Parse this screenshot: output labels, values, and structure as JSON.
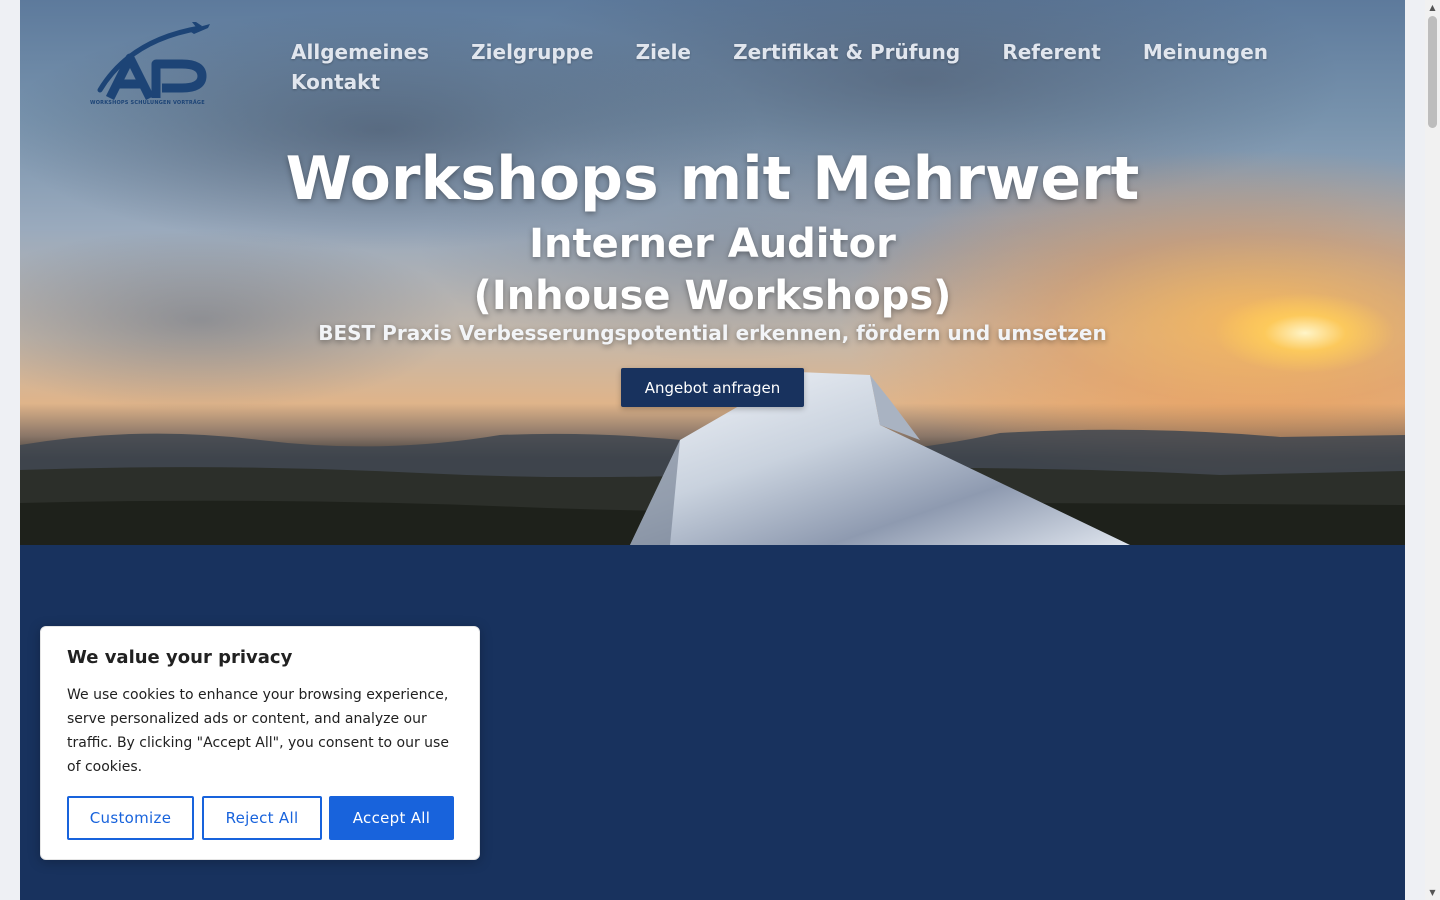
{
  "logo": {
    "icon": "airplane-icon",
    "letters": "AP",
    "tagline": "WORKSHOPS SCHULUNGEN VORTRÄGE",
    "color": "#1d4476"
  },
  "nav": {
    "items": [
      {
        "label": "Allgemeines"
      },
      {
        "label": "Zielgruppe"
      },
      {
        "label": "Ziele"
      },
      {
        "label": "Zertifikat & Prüfung"
      },
      {
        "label": "Referent"
      },
      {
        "label": "Meinungen"
      },
      {
        "label": "Kontakt"
      }
    ]
  },
  "hero": {
    "title": "Workshops mit Mehrwert",
    "subtitle_line1": "Interner Auditor",
    "subtitle_line2": "(Inhouse Workshops)",
    "tagline": "BEST Praxis Verbesserungspotential erkennen, fördern und umsetzen",
    "cta_label": "Angebot anfragen"
  },
  "cookie": {
    "title": "We value your privacy",
    "text": "We use cookies to enhance your browsing experience, serve personalized ads or content, and analyze our traffic. By clicking \"Accept All\", you consent to our use of cookies.",
    "customize_label": "Customize",
    "reject_label": "Reject All",
    "accept_label": "Accept All"
  },
  "colors": {
    "navy": "#18325e",
    "accent": "#1863dc",
    "nav_text": "#e1e6ee"
  }
}
